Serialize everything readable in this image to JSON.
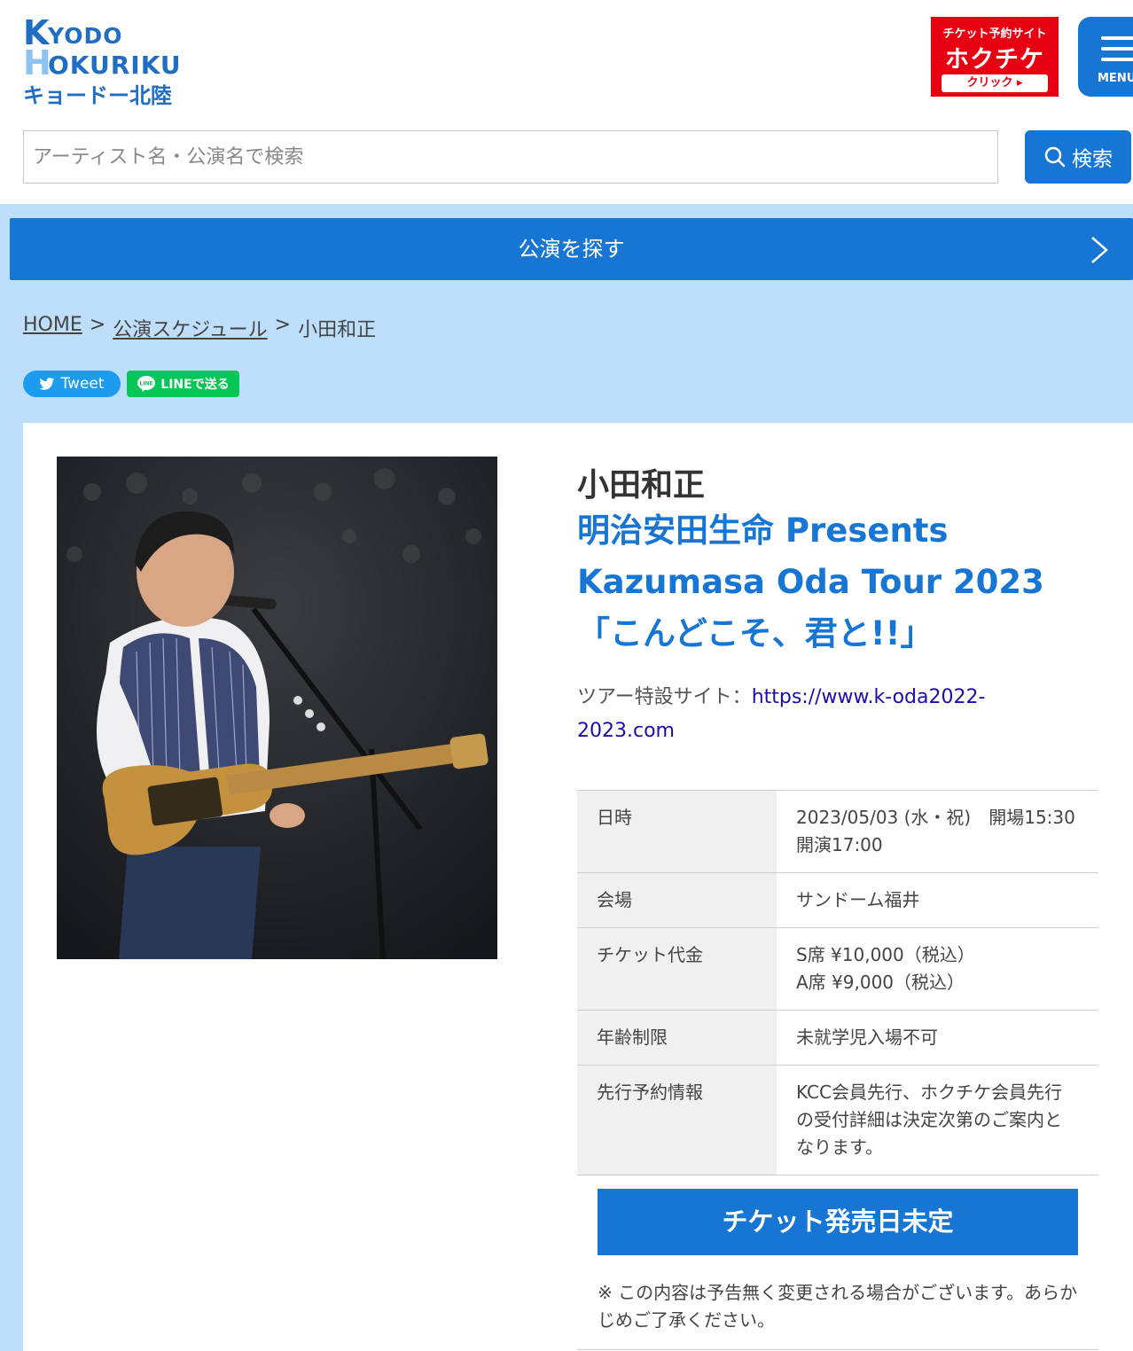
{
  "header": {
    "logo": {
      "k": "K",
      "yodo": "YODO",
      "h": "H",
      "okuriku": "OKURIKU",
      "jp": "キョードー北陸"
    },
    "hokuchike": {
      "top": "チケット予約サイト",
      "brand": "ホクチケ",
      "cta": "クリック ▸"
    },
    "menu_label": "MENU",
    "search": {
      "placeholder": "アーティスト名・公演名で検索",
      "button_label": "検索"
    }
  },
  "nav": {
    "find_label": "公演を探す"
  },
  "breadcrumb": {
    "home": "HOME",
    "sep1": ">",
    "schedule": "公演スケジュール",
    "sep2": ">",
    "current": "小田和正"
  },
  "share": {
    "tweet_label": "Tweet",
    "line_label": "LINEで送る"
  },
  "event": {
    "artist": "小田和正",
    "title_line1": "明治安田生命 Presents",
    "title_line2": "Kazumasa Oda Tour 2023",
    "title_line3": "「こんどこそ、君と!!」",
    "tour_site_label": "ツアー特設サイト：",
    "tour_site_url": "https://www.k-oda2022-2023.com",
    "info": [
      {
        "label": "日時",
        "value": "2023/05/03 (水・祝)　開場15:30　開演17:00"
      },
      {
        "label": "会場",
        "value": "サンドーム福井"
      },
      {
        "label": "チケット代金",
        "value_lines": [
          "S席 ¥10,000（税込）",
          "A席 ¥9,000（税込）"
        ]
      },
      {
        "label": "年齢制限",
        "value": "未就学児入場不可"
      },
      {
        "label": "先行予約情報",
        "value": "KCC会員先行、ホクチケ会員先行の受付詳細は決定次第のご案内となります。"
      }
    ],
    "ticket_button": "チケット発売日未定",
    "notice": "※ この内容は予告無く変更される場合がございます。あらかじめご了承ください。"
  },
  "colors": {
    "primary": "#1776d3",
    "page_bg": "#bddffb",
    "hokuchike_red": "#e60012",
    "line_green": "#06c755",
    "twitter_blue": "#1d9bf0"
  }
}
